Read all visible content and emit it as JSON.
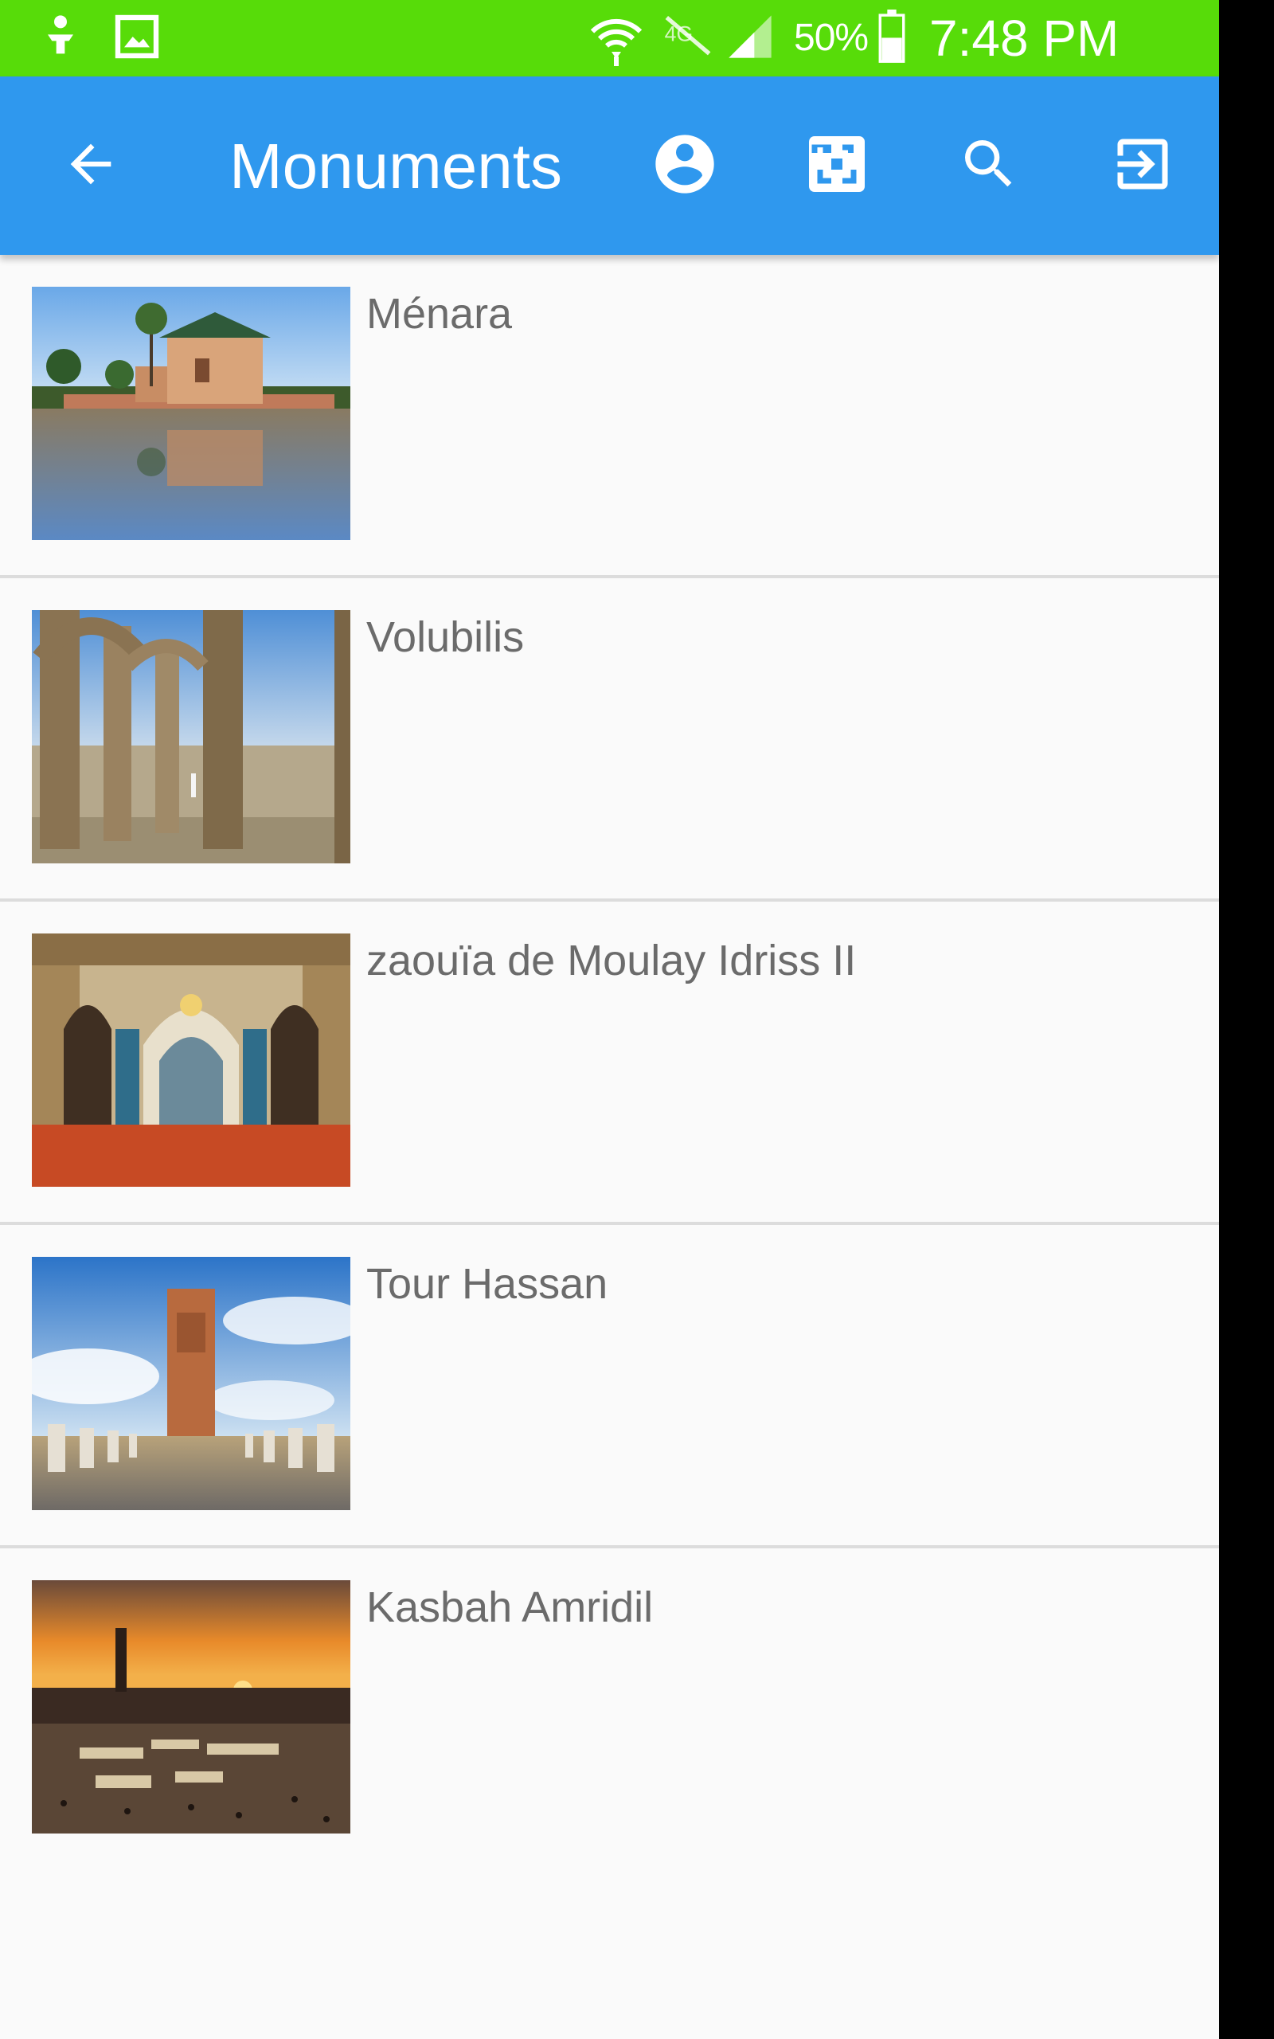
{
  "status_bar": {
    "battery_text": "50%",
    "time": "7:48 PM",
    "background": "#57dc09",
    "icons": [
      "download-icon",
      "image-icon",
      "wifi-icon",
      "lte-signal-off-icon",
      "signal-icon",
      "battery-icon"
    ]
  },
  "app_bar": {
    "title": "Monuments",
    "background": "#2f98ee",
    "icons": [
      "back-arrow-icon",
      "account-circle-icon",
      "qr-scan-icon",
      "search-icon",
      "exit-icon"
    ]
  },
  "monuments": [
    {
      "label": "Ménara",
      "image": "menara-pavilion-photo"
    },
    {
      "label": "Volubilis",
      "image": "volubilis-ruins-photo"
    },
    {
      "label": "zaouïa de Moulay Idriss II",
      "image": "moulay-idriss-zaouia-photo"
    },
    {
      "label": "Tour Hassan",
      "image": "hassan-tower-photo"
    },
    {
      "label": "Kasbah Amridil",
      "image": "kasbah-sunset-photo"
    }
  ]
}
